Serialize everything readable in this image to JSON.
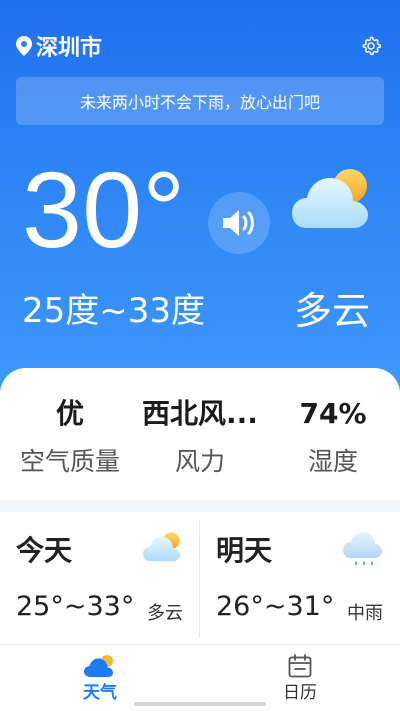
{
  "header": {
    "city": "深圳市",
    "location_icon": "location-pin-icon",
    "settings_icon": "gear-icon"
  },
  "notice": "未来两小时不会下雨，放心出门吧",
  "current": {
    "temperature": "30°",
    "range": "25度~33度",
    "condition": "多云",
    "condition_icon": "partly-cloudy-icon",
    "speaker_icon": "speaker-icon"
  },
  "stats": [
    {
      "value": "优",
      "label": "空气质量"
    },
    {
      "value": "西北风...",
      "label": "风力"
    },
    {
      "value": "74%",
      "label": "湿度"
    }
  ],
  "forecast": [
    {
      "day": "今天",
      "temp": "25°~33°",
      "condition": "多云",
      "icon": "partly-cloudy-icon"
    },
    {
      "day": "明天",
      "temp": "26°~31°",
      "condition": "中雨",
      "icon": "rain-cloud-icon"
    }
  ],
  "tabs": [
    {
      "label": "天气",
      "icon": "weather-icon",
      "active": true
    },
    {
      "label": "日历",
      "icon": "calendar-icon",
      "active": false
    }
  ],
  "colors": {
    "hero_top": "#1f6ff0",
    "hero_bottom": "#3f98fb",
    "active_tab": "#1e7cf2",
    "inactive_tab": "#333333"
  }
}
